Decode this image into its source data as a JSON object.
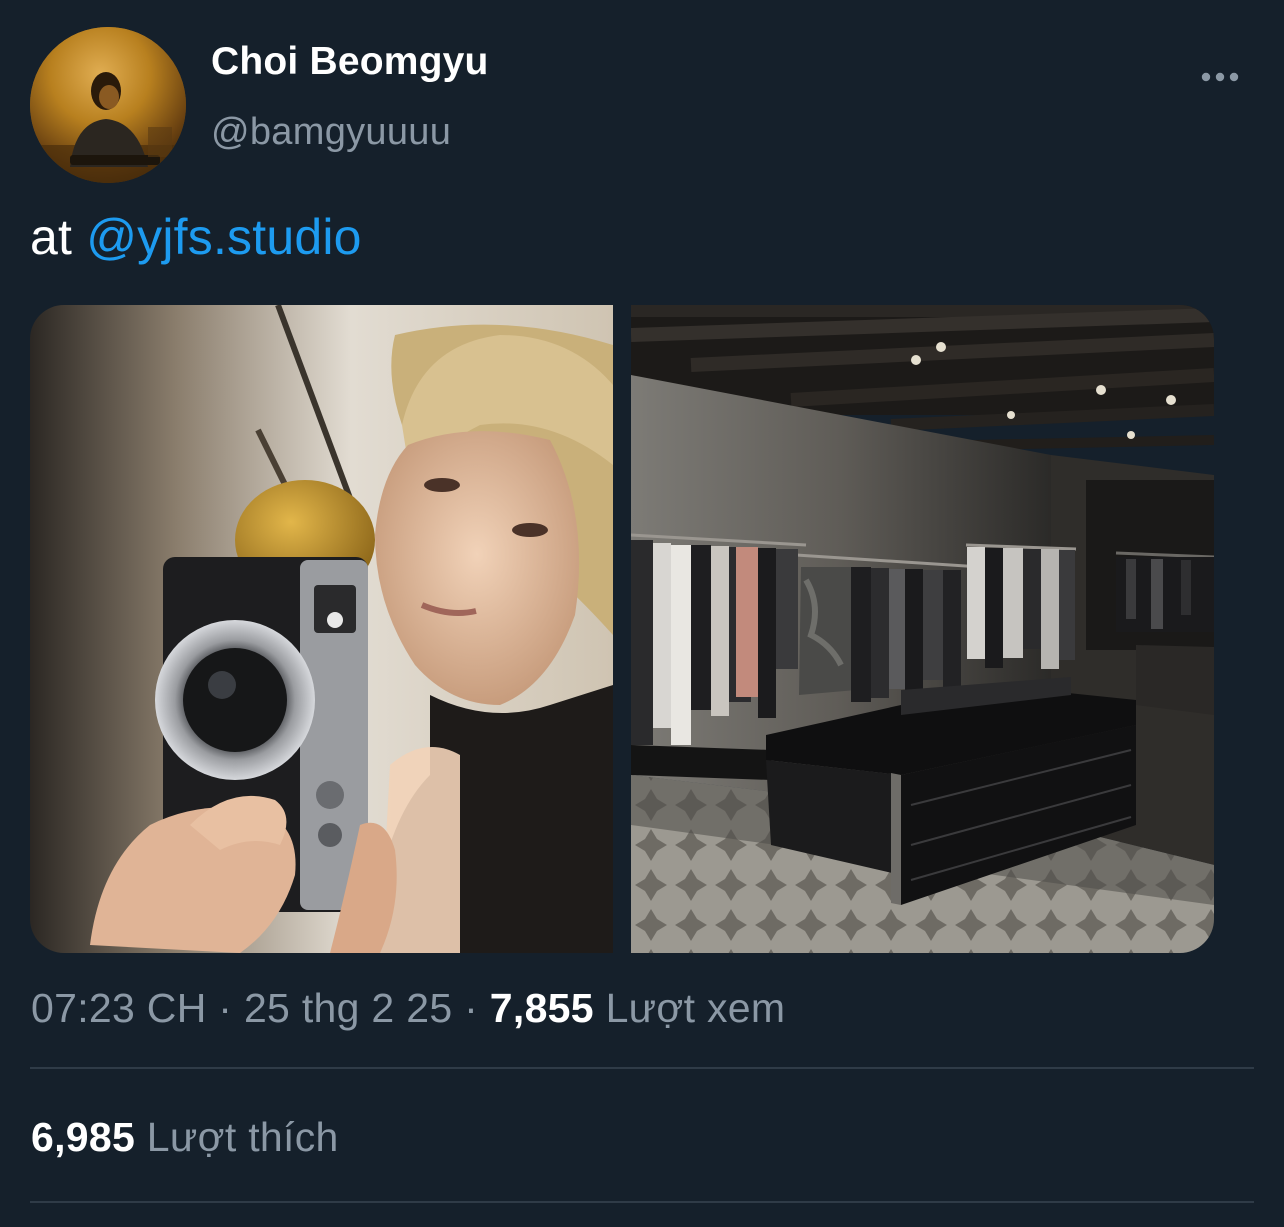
{
  "author": {
    "display_name": "Choi Beomgyu",
    "handle": "@bamgyuuuu"
  },
  "more_icon": "ellipsis-horizontal-icon",
  "tweet": {
    "text_prefix": "at ",
    "mention": "@yjfs.studio"
  },
  "media": [
    {
      "description_icon": "photo-selfie-with-camera"
    },
    {
      "description_icon": "photo-clothing-store-interior"
    }
  ],
  "meta": {
    "time": "07:23 CH",
    "separator_1": " · ",
    "date": "25 thg 2 25",
    "separator_2": " · ",
    "views_count": "7,855",
    "views_label": " Lượt xem"
  },
  "stats": {
    "likes_count": "6,985",
    "likes_label": " Lượt thích"
  },
  "colors": {
    "background": "#15202b",
    "primary_text": "#ffffff",
    "secondary_text": "#8b98a5",
    "link": "#1d9bf0",
    "divider": "#2f3b47"
  }
}
